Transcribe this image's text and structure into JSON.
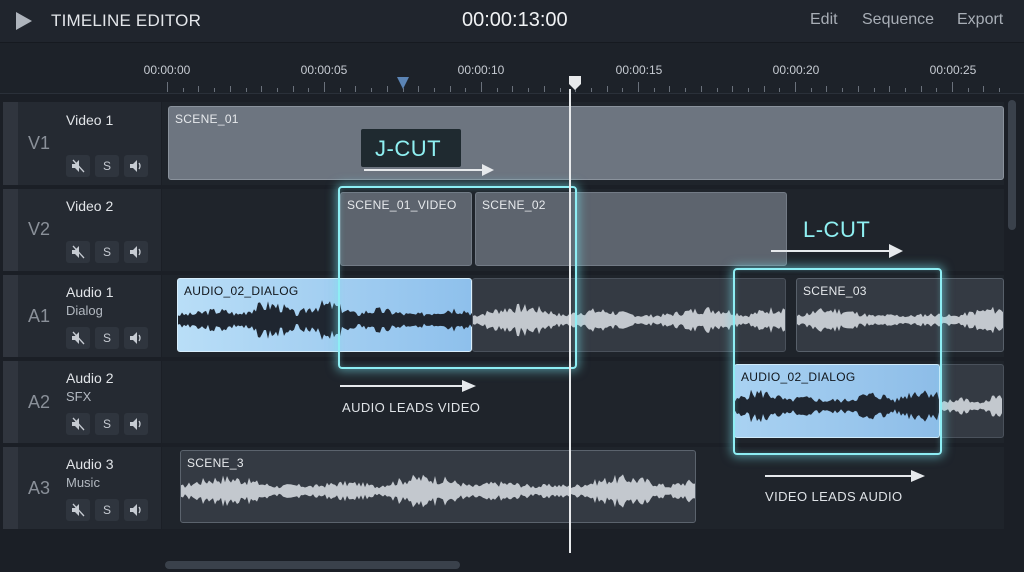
{
  "app": {
    "title": "TIMELINE EDITOR",
    "timecode": "00:00:13:00",
    "menu": [
      "Edit",
      "Sequence",
      "Export"
    ]
  },
  "ruler": {
    "labels": [
      "00:00:00",
      "00:00:05",
      "00:00:10",
      "00:00:15",
      "00:00:20",
      "00:00:25"
    ],
    "in_marker_seconds": 7.5,
    "playhead_seconds": 13
  },
  "tracks": [
    {
      "id": "V1",
      "name": "Video 1",
      "sub": ""
    },
    {
      "id": "V2",
      "name": "Video 2",
      "sub": ""
    },
    {
      "id": "A1",
      "name": "Audio 1",
      "sub": "Dialog"
    },
    {
      "id": "A2",
      "name": "Audio 2",
      "sub": "SFX"
    },
    {
      "id": "A3",
      "name": "Audio 3",
      "sub": "Music"
    }
  ],
  "track_buttons": {
    "mute_icon": "speaker-mute-icon",
    "solo_label": "S",
    "volume_icon": "speaker-volume-icon"
  },
  "clips": {
    "v1_scene": "SCENE_01",
    "v2_scene01": "SCENE_01_VIDEO",
    "v2_scene02": "SCENE_02",
    "a1_dialog": "AUDIO_02_DIALOG",
    "a1_scene03": "SCENE_03",
    "a2_dialog": "AUDIO_02_DIALOG",
    "a3_scene": "SCENE_3"
  },
  "annotations": {
    "jcut": "J-CUT",
    "lcut": "L-CUT",
    "jcut_caption": "AUDIO LEADS VIDEO",
    "lcut_caption": "VIDEO LEADS AUDIO"
  },
  "colors": {
    "accent_glow": "#8eeef4",
    "highlight_clip": "#a9d2f2",
    "playhead": "#e8eaec",
    "in_marker": "#5b84b4"
  }
}
